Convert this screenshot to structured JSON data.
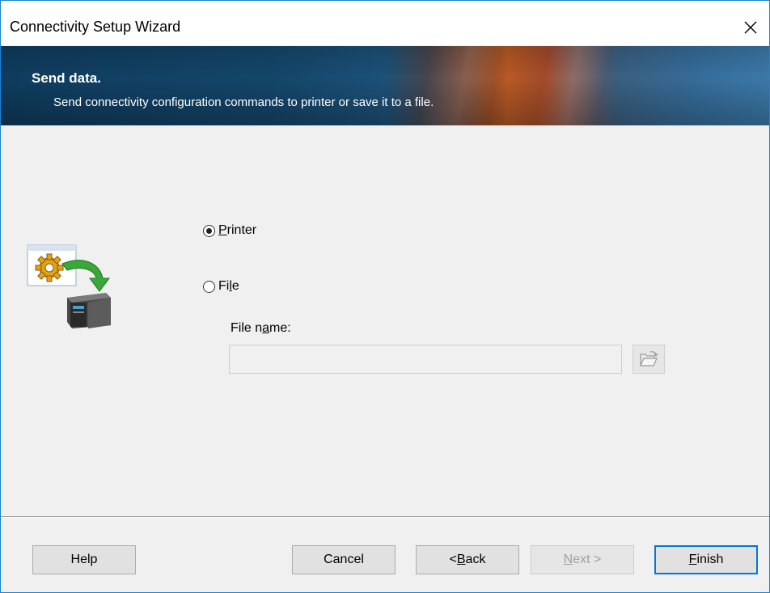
{
  "window": {
    "title": "Connectivity Setup Wizard"
  },
  "header": {
    "title": "Send data.",
    "subtitle": "Send connectivity configuration commands to printer or save it to a file."
  },
  "options": {
    "printer": {
      "prefix": "",
      "mnemonic": "P",
      "suffix": "rinter",
      "selected": true
    },
    "file": {
      "prefix": "Fi",
      "mnemonic": "l",
      "suffix": "e",
      "selected": false
    }
  },
  "filename": {
    "label_prefix": "File n",
    "label_mnemonic": "a",
    "label_suffix": "me:",
    "value": "",
    "placeholder": ""
  },
  "footer": {
    "help": "Help",
    "cancel": "Cancel",
    "back_prefix": "< ",
    "back_mnemonic": "B",
    "back_suffix": "ack",
    "next_mnemonic": "N",
    "next_suffix": "ext >",
    "finish_mnemonic": "F",
    "finish_suffix": "inish"
  },
  "icons": {
    "close": "close-icon",
    "wizard": "send-config-to-printer-icon",
    "browse": "folder-open-icon"
  },
  "colors": {
    "accent": "#0078d7",
    "window_border": "#1883d7",
    "banner_dark": "#14466b",
    "banner_orange": "#b85a24"
  }
}
